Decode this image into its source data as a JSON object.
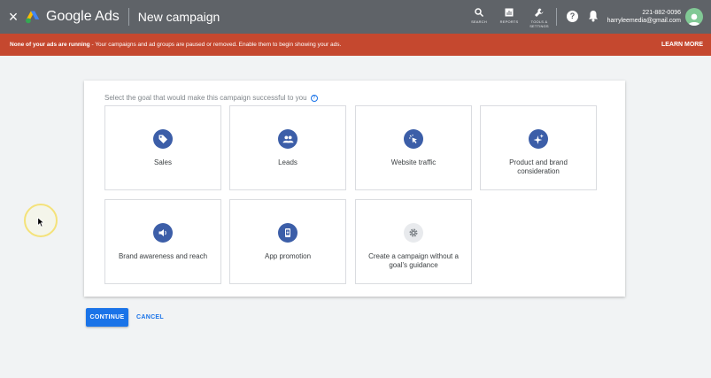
{
  "header": {
    "close_glyph": "×",
    "brand": "Google Ads",
    "page_title": "New campaign",
    "tools": [
      {
        "icon": "search-icon",
        "label": "SEARCH"
      },
      {
        "icon": "reports-icon",
        "label": "REPORTS"
      },
      {
        "icon": "wrench-icon",
        "label": "TOOLS & SETTINGS"
      }
    ],
    "help_glyph": "?",
    "account": {
      "phone": "221-882-0096",
      "email": "harryleemedia@gmail.com"
    }
  },
  "banner": {
    "strong": "None of your ads are running",
    "text": " - Your campaigns and ad groups are paused or removed. Enable them to begin showing your ads.",
    "action": "LEARN MORE"
  },
  "goals": {
    "prompt": "Select the goal that would make this campaign successful to you",
    "help_glyph": "?",
    "items": [
      {
        "label": "Sales",
        "icon": "tag-icon"
      },
      {
        "label": "Leads",
        "icon": "people-icon"
      },
      {
        "label": "Website traffic",
        "icon": "cursor-click-icon"
      },
      {
        "label": "Product and brand consideration",
        "icon": "sparkle-icon"
      },
      {
        "label": "Brand awareness and reach",
        "icon": "speaker-icon"
      },
      {
        "label": "App promotion",
        "icon": "phone-icon"
      },
      {
        "label": "Create a campaign without a goal's guidance",
        "icon": "gear-icon"
      }
    ]
  },
  "actions": {
    "continue": "CONTINUE",
    "cancel": "CANCEL"
  },
  "colors": {
    "topbar": "#5f6368",
    "banner": "#c5482f",
    "accent": "#1a73e8",
    "goal_icon": "#3c5ea8"
  }
}
